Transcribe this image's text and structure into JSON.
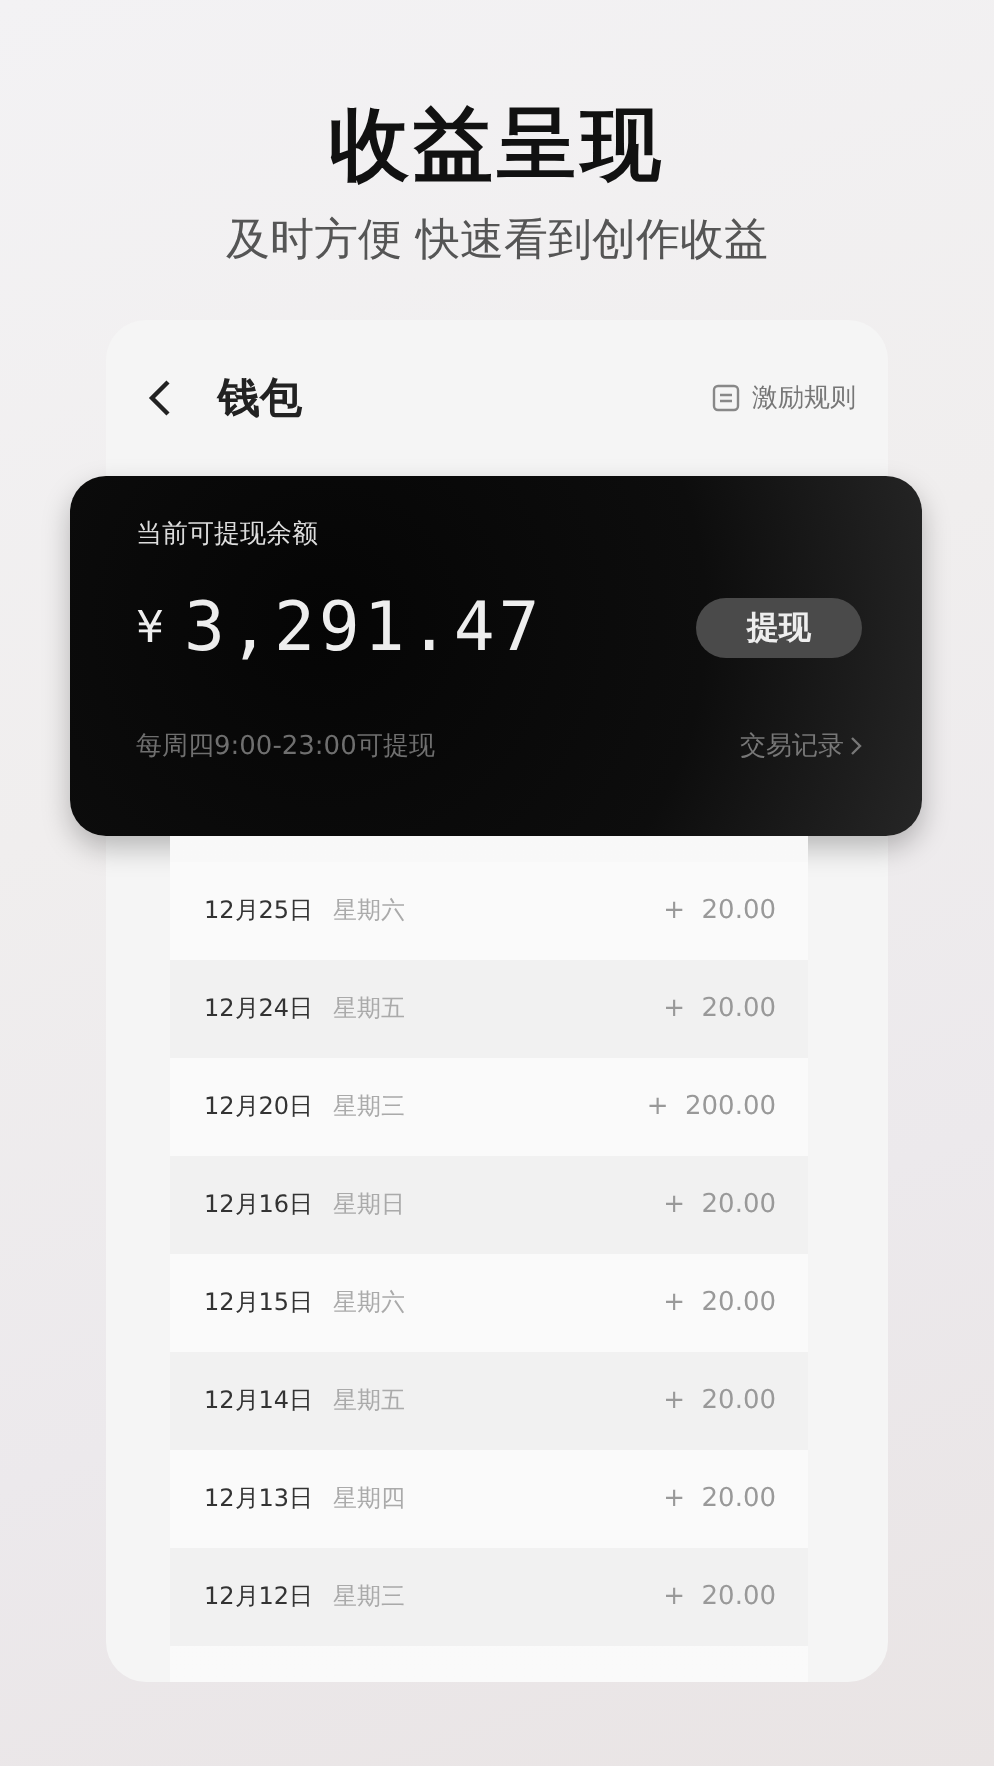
{
  "headline": "收益呈现",
  "subtitle": "及时方便 快速看到创作收益",
  "header": {
    "title": "钱包",
    "rules_link": "激励规则"
  },
  "balance_card": {
    "label": "当前可提现余额",
    "currency": "¥",
    "amount": "3,291.47",
    "withdraw_button": "提现",
    "note": "每周四9:00-23:00可提现",
    "records_link": "交易记录"
  },
  "transactions": [
    {
      "date": "12月25日",
      "weekday": "星期六",
      "amount": "+  20.00"
    },
    {
      "date": "12月24日",
      "weekday": "星期五",
      "amount": "+  20.00"
    },
    {
      "date": "12月20日",
      "weekday": "星期三",
      "amount": "+  200.00"
    },
    {
      "date": "12月16日",
      "weekday": "星期日",
      "amount": "+  20.00"
    },
    {
      "date": "12月15日",
      "weekday": "星期六",
      "amount": "+  20.00"
    },
    {
      "date": "12月14日",
      "weekday": "星期五",
      "amount": "+  20.00"
    },
    {
      "date": "12月13日",
      "weekday": "星期四",
      "amount": "+  20.00"
    },
    {
      "date": "12月12日",
      "weekday": "星期三",
      "amount": "+  20.00"
    }
  ]
}
